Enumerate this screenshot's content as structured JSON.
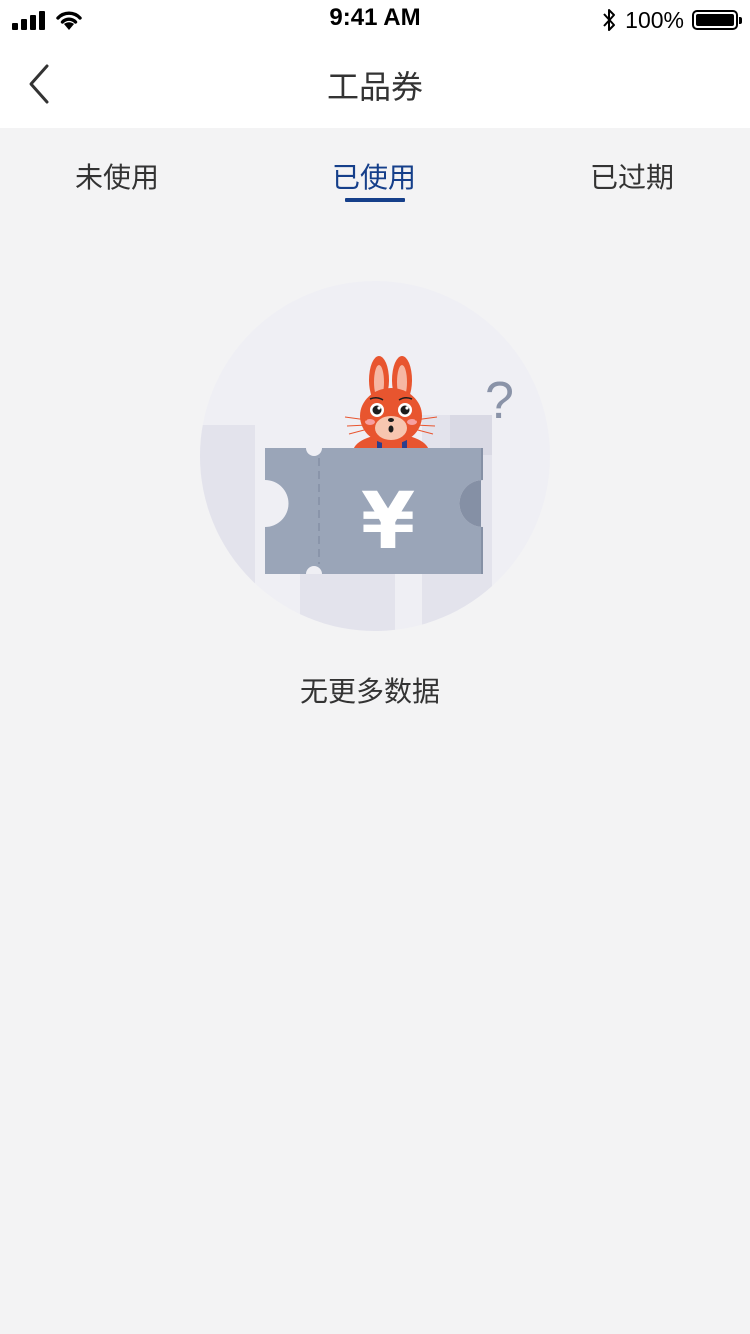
{
  "status_bar": {
    "time": "9:41 AM",
    "battery_text": "100%",
    "icons": [
      "signal-icon",
      "wifi-icon",
      "bluetooth-icon",
      "battery-icon"
    ]
  },
  "nav": {
    "title": "工品券",
    "back_icon": "chevron-left-icon"
  },
  "tabs": [
    {
      "label": "未使用",
      "active": false
    },
    {
      "label": "已使用",
      "active": true
    },
    {
      "label": "已过期",
      "active": false
    }
  ],
  "empty_state": {
    "illustration": "rabbit-with-coupon-illustration",
    "coupon_symbol": "¥",
    "question_mark": "?",
    "message": "无更多数据"
  },
  "colors": {
    "accent": "#153f8a",
    "background": "#f3f3f4",
    "header_bg": "#ffffff",
    "coupon": "#9aa5b8",
    "rabbit": "#e8552f"
  }
}
